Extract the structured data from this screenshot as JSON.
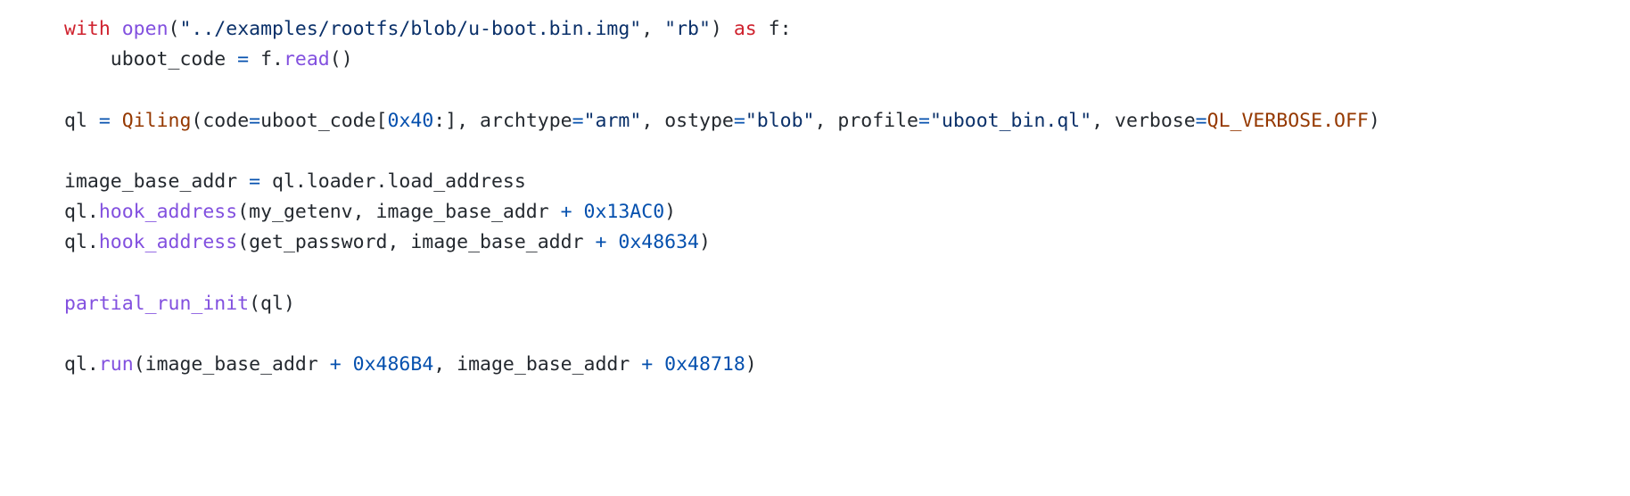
{
  "editor": {
    "background_color": "#ffffff",
    "language": "python",
    "theme_colors": {
      "plain": "#24292f",
      "keyword": "#cf222e",
      "function": "#8250df",
      "string": "#0a3069",
      "number": "#0550ae",
      "operator": "#0550ae",
      "class_constant": "#953800"
    }
  },
  "code": {
    "lines": [
      {
        "index": 0,
        "text": "with open(\"../examples/rootfs/blob/u-boot.bin.img\", \"rb\") as f:",
        "tokens": [
          {
            "t": "with",
            "c": "t-keyword"
          },
          {
            "t": " ",
            "c": "t-plain"
          },
          {
            "t": "open",
            "c": "t-func"
          },
          {
            "t": "(",
            "c": "t-punct"
          },
          {
            "t": "\"../examples/rootfs/blob/u-boot.bin.img\"",
            "c": "t-string"
          },
          {
            "t": ", ",
            "c": "t-punct"
          },
          {
            "t": "\"rb\"",
            "c": "t-string"
          },
          {
            "t": ")",
            "c": "t-punct"
          },
          {
            "t": " ",
            "c": "t-plain"
          },
          {
            "t": "as",
            "c": "t-keyword"
          },
          {
            "t": " f:",
            "c": "t-plain"
          }
        ]
      },
      {
        "index": 1,
        "text": "    uboot_code = f.read()",
        "tokens": [
          {
            "t": "    uboot_code ",
            "c": "t-plain"
          },
          {
            "t": "=",
            "c": "t-operator"
          },
          {
            "t": " f.",
            "c": "t-plain"
          },
          {
            "t": "read",
            "c": "t-func"
          },
          {
            "t": "()",
            "c": "t-punct"
          }
        ]
      },
      {
        "index": 2,
        "text": "",
        "tokens": []
      },
      {
        "index": 3,
        "text": "ql = Qiling(code=uboot_code[0x40:], archtype=\"arm\", ostype=\"blob\", profile=\"uboot_bin.ql\", verbose=QL_VERBOSE.OFF)",
        "tokens": [
          {
            "t": "ql ",
            "c": "t-plain"
          },
          {
            "t": "=",
            "c": "t-operator"
          },
          {
            "t": " ",
            "c": "t-plain"
          },
          {
            "t": "Qiling",
            "c": "t-class"
          },
          {
            "t": "(code",
            "c": "t-punct"
          },
          {
            "t": "=",
            "c": "t-operator"
          },
          {
            "t": "uboot_code[",
            "c": "t-plain"
          },
          {
            "t": "0x40",
            "c": "t-number"
          },
          {
            "t": ":], archtype",
            "c": "t-punct"
          },
          {
            "t": "=",
            "c": "t-operator"
          },
          {
            "t": "\"arm\"",
            "c": "t-string"
          },
          {
            "t": ", ostype",
            "c": "t-punct"
          },
          {
            "t": "=",
            "c": "t-operator"
          },
          {
            "t": "\"blob\"",
            "c": "t-string"
          },
          {
            "t": ", profile",
            "c": "t-punct"
          },
          {
            "t": "=",
            "c": "t-operator"
          },
          {
            "t": "\"uboot_bin.ql\"",
            "c": "t-string"
          },
          {
            "t": ", verbose",
            "c": "t-punct"
          },
          {
            "t": "=",
            "c": "t-operator"
          },
          {
            "t": "QL_VERBOSE.OFF",
            "c": "t-class"
          },
          {
            "t": ")",
            "c": "t-punct"
          }
        ]
      },
      {
        "index": 4,
        "text": "",
        "tokens": []
      },
      {
        "index": 5,
        "text": "image_base_addr = ql.loader.load_address",
        "tokens": [
          {
            "t": "image_base_addr ",
            "c": "t-plain"
          },
          {
            "t": "=",
            "c": "t-operator"
          },
          {
            "t": " ql.loader.load_address",
            "c": "t-plain"
          }
        ]
      },
      {
        "index": 6,
        "text": "ql.hook_address(my_getenv, image_base_addr + 0x13AC0)",
        "tokens": [
          {
            "t": "ql.",
            "c": "t-plain"
          },
          {
            "t": "hook_address",
            "c": "t-func"
          },
          {
            "t": "(my_getenv, image_base_addr ",
            "c": "t-punct"
          },
          {
            "t": "+",
            "c": "t-operator"
          },
          {
            "t": " ",
            "c": "t-plain"
          },
          {
            "t": "0x13AC0",
            "c": "t-number"
          },
          {
            "t": ")",
            "c": "t-punct"
          }
        ]
      },
      {
        "index": 7,
        "text": "ql.hook_address(get_password, image_base_addr + 0x48634)",
        "tokens": [
          {
            "t": "ql.",
            "c": "t-plain"
          },
          {
            "t": "hook_address",
            "c": "t-func"
          },
          {
            "t": "(get_password, image_base_addr ",
            "c": "t-punct"
          },
          {
            "t": "+",
            "c": "t-operator"
          },
          {
            "t": " ",
            "c": "t-plain"
          },
          {
            "t": "0x48634",
            "c": "t-number"
          },
          {
            "t": ")",
            "c": "t-punct"
          }
        ]
      },
      {
        "index": 8,
        "text": "",
        "tokens": []
      },
      {
        "index": 9,
        "text": "partial_run_init(ql)",
        "tokens": [
          {
            "t": "partial_run_init",
            "c": "t-func"
          },
          {
            "t": "(ql)",
            "c": "t-punct"
          }
        ]
      },
      {
        "index": 10,
        "text": "",
        "tokens": []
      },
      {
        "index": 11,
        "text": "ql.run(image_base_addr + 0x486B4, image_base_addr + 0x48718)",
        "tokens": [
          {
            "t": "ql.",
            "c": "t-plain"
          },
          {
            "t": "run",
            "c": "t-func"
          },
          {
            "t": "(image_base_addr ",
            "c": "t-punct"
          },
          {
            "t": "+",
            "c": "t-operator"
          },
          {
            "t": " ",
            "c": "t-plain"
          },
          {
            "t": "0x486B4",
            "c": "t-number"
          },
          {
            "t": ", image_base_addr ",
            "c": "t-punct"
          },
          {
            "t": "+",
            "c": "t-operator"
          },
          {
            "t": " ",
            "c": "t-plain"
          },
          {
            "t": "0x48718",
            "c": "t-number"
          },
          {
            "t": ")",
            "c": "t-punct"
          }
        ]
      }
    ]
  }
}
